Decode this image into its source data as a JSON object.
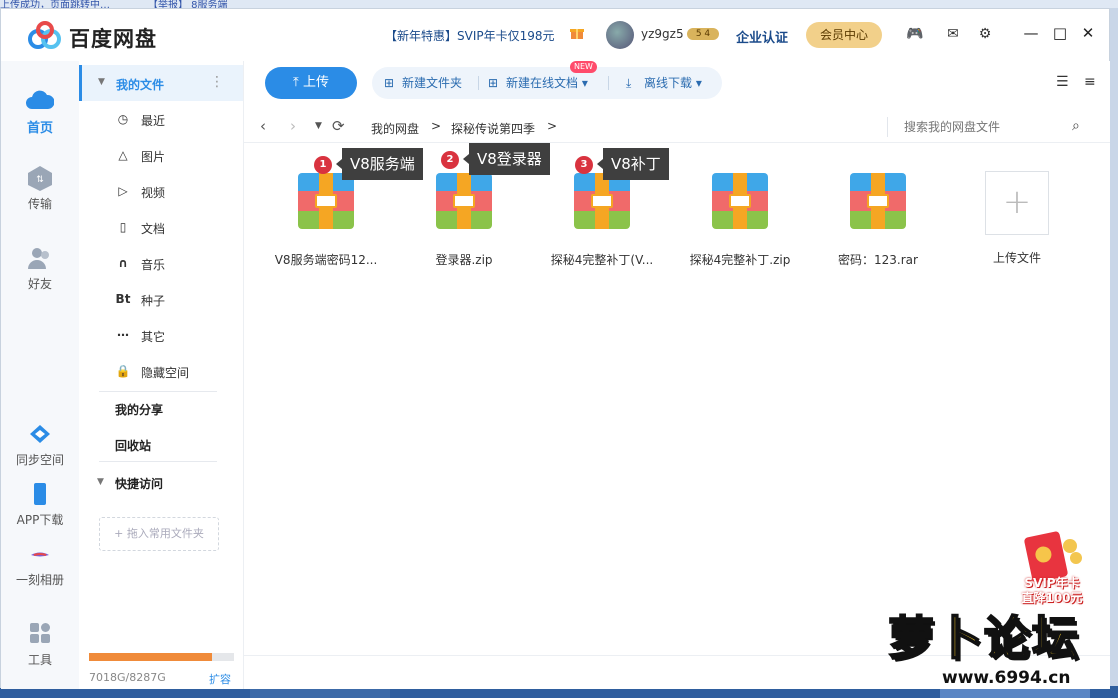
{
  "background": {
    "top_text": "上传成功，页面跳转中…",
    "top_text2": "【举报】  8服务端"
  },
  "titlebar": {
    "brand": "百度网盘",
    "promo": "【新年特惠】SVIP年卡仅198元",
    "username": "yz9gz5",
    "vip_badge": "5 4",
    "enterprise": "企业认证",
    "vip_center": "会员中心",
    "icons": {
      "gift": "gift-icon",
      "game": "gamepad-icon",
      "mail": "mail-icon",
      "settings": "gear-icon",
      "minimize": "minimize-icon",
      "maximize": "maximize-icon",
      "close": "close-icon"
    }
  },
  "leftnav": {
    "items": [
      {
        "label": "首页",
        "icon": "cloud-icon",
        "active": true
      },
      {
        "label": "传输",
        "icon": "transfer-icon"
      },
      {
        "label": "好友",
        "icon": "friends-icon"
      },
      {
        "label": "同步空间",
        "icon": "sync-icon"
      },
      {
        "label": "APP下载",
        "icon": "phone-icon"
      },
      {
        "label": "一刻相册",
        "icon": "album-icon"
      },
      {
        "label": "工具",
        "icon": "tools-icon"
      }
    ]
  },
  "sidebar": {
    "my_files": "我的文件",
    "items": [
      {
        "label": "最近",
        "icon": "clock-icon"
      },
      {
        "label": "图片",
        "icon": "image-icon"
      },
      {
        "label": "视频",
        "icon": "play-icon"
      },
      {
        "label": "文档",
        "icon": "document-icon"
      },
      {
        "label": "音乐",
        "icon": "headphones-icon"
      },
      {
        "label": "种子",
        "icon": "bt-icon",
        "glyph": "Bt"
      },
      {
        "label": "其它",
        "icon": "more-icon"
      },
      {
        "label": "隐藏空间",
        "icon": "lock-icon"
      }
    ],
    "my_share": "我的分享",
    "recycle": "回收站",
    "quick_access": "快捷访问",
    "drop_hint": "+ 拖入常用文件夹",
    "storage": {
      "used_fraction": 0.848,
      "text": "7018G/8287G",
      "expand": "扩容"
    }
  },
  "toolbar": {
    "upload": "上传",
    "new_folder": "新建文件夹",
    "new_online_doc": "新建在线文档",
    "new_badge": "NEW",
    "offline_download": "离线下载"
  },
  "pathbar": {
    "crumbs": [
      "我的网盘",
      "探秘传说第四季"
    ],
    "separator": ">",
    "search_placeholder": "搜索我的网盘文件"
  },
  "files": [
    {
      "name": "V8服务端密码12...",
      "type": "zip"
    },
    {
      "name": "登录器.zip",
      "type": "zip"
    },
    {
      "name": "探秘4完整补丁(V...",
      "type": "zip"
    },
    {
      "name": "探秘4完整补丁.zip",
      "type": "zip"
    },
    {
      "name": "密码：123.rar",
      "type": "zip"
    }
  ],
  "upload_tile_label": "上传文件",
  "annotations": [
    {
      "num": "1",
      "text": "V8服务端"
    },
    {
      "num": "2",
      "text": "V8登录器"
    },
    {
      "num": "3",
      "text": "V8补丁"
    }
  ],
  "promo_widget": {
    "text_line1": "SVIP年卡",
    "text_line2": "直降100元"
  },
  "watermark": {
    "text": "萝卜论坛",
    "url": "www.6994.cn"
  },
  "colors": {
    "accent": "#2b8ce6",
    "storage": "#f08b3a",
    "annotation": "#d9333f"
  }
}
